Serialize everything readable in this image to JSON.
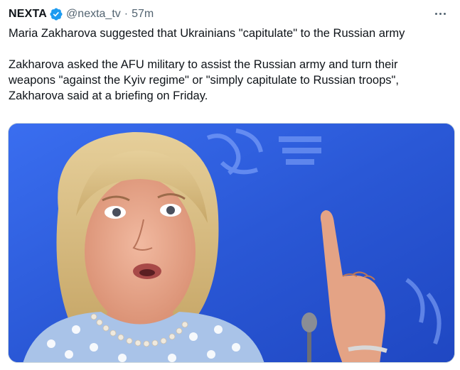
{
  "tweet": {
    "display_name": "NEXTA",
    "handle": "@nexta_tv",
    "separator": "·",
    "time": "57m",
    "verified_icon": "verified-badge-icon",
    "more_icon": "more-options-icon",
    "text": {
      "line1": "Maria Zakharova suggested that Ukrainians \"capitulate\" to the Russian army",
      "line2": "Zakharova asked the AFU military to assist the Russian army and turn their",
      "line3": "weapons \"against the Kyiv regime\" or \"simply capitulate to Russian troops\",",
      "line4": "Zakharova said at a briefing on Friday."
    },
    "media": {
      "type": "photo",
      "alt_subject": "woman pointing finger upward in front of blue backdrop"
    },
    "colors": {
      "verified_blue": "#1d9bf0",
      "text_primary": "#0f1419",
      "text_secondary": "#536471",
      "backdrop_blue": "#2f5fd8"
    }
  }
}
